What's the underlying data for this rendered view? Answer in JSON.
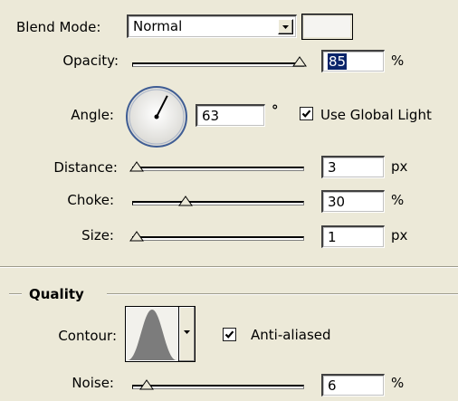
{
  "blend_mode": {
    "label": "Blend Mode:",
    "value": "Normal",
    "swatch_color": "#f5f4f1"
  },
  "opacity": {
    "label": "Opacity:",
    "value": "85",
    "unit": "%",
    "level": 1.0
  },
  "angle": {
    "label": "Angle:",
    "value": "63",
    "unit": "°",
    "use_global_light": {
      "label": "Use Global Light",
      "checked": true
    }
  },
  "distance": {
    "label": "Distance:",
    "value": "3",
    "unit": "px",
    "level": 0.0
  },
  "choke": {
    "label": "Choke:",
    "value": "30",
    "unit": "%",
    "level": 0.3
  },
  "size": {
    "label": "Size:",
    "value": "1",
    "unit": "px",
    "level": 0.0
  },
  "quality": {
    "heading": "Quality"
  },
  "contour": {
    "label": "Contour:",
    "anti_aliased": {
      "label": "Anti-aliased",
      "checked": true
    }
  },
  "noise": {
    "label": "Noise:",
    "value": "6",
    "unit": "%",
    "level": 0.06
  },
  "colors": {
    "panel_bg": "#ece9d8",
    "selection": "#0a246a"
  }
}
